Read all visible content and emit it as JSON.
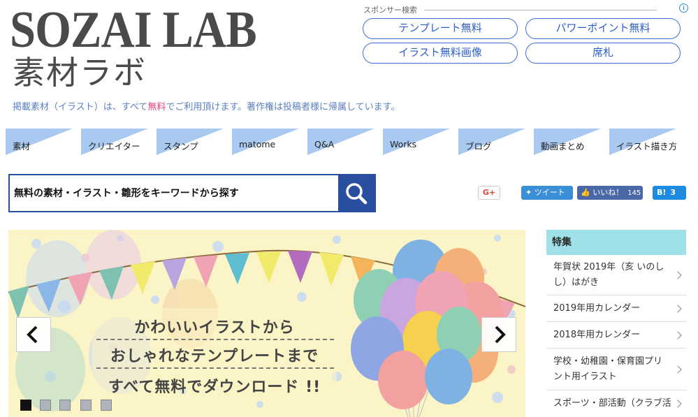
{
  "header": {
    "logo_en": "SOZAI LAB",
    "logo_jp": "素材ラボ",
    "tagline_before": "掲載素材（イラスト）は、すべて",
    "tagline_free": "無料",
    "tagline_after": "でご利用頂けます。著作権は投稿者様に帰属しています。"
  },
  "sponsor": {
    "title": "スポンサー検索",
    "info_icon": "i",
    "buttons": [
      "テンプレート無料",
      "パワーポイント無料",
      "イラスト無料画像",
      "席札"
    ]
  },
  "nav": {
    "items": [
      "素材",
      "クリエイター",
      "スタンプ",
      "matome",
      "Q&A",
      "Works",
      "ブログ",
      "動画まとめ",
      "イラスト描き方"
    ]
  },
  "search": {
    "placeholder": "無料の素材・イラスト・雛形をキーワードから探す",
    "icon": "search-icon"
  },
  "social": {
    "gplus": "G+",
    "tweet": "ツイート",
    "like": "いいね！",
    "like_count": "145",
    "hatena": "B!",
    "hatena_count": "3"
  },
  "slider": {
    "line1": "かわいいイラストから",
    "line2": "おしゃれなテンプレートまで",
    "line3": "すべて無料でダウンロード !!",
    "dots": 5,
    "active_dot": 0,
    "bg_color": "#fbf4c6"
  },
  "sidebar": {
    "title": "特集",
    "items": [
      "年賀状 2019年（亥 いのしし）はがき",
      "2019年用カレンダー",
      "2018年用カレンダー",
      "学校・幼稚園・保育園プリント用イラスト",
      "スポーツ・部活動（クラブ活"
    ]
  }
}
